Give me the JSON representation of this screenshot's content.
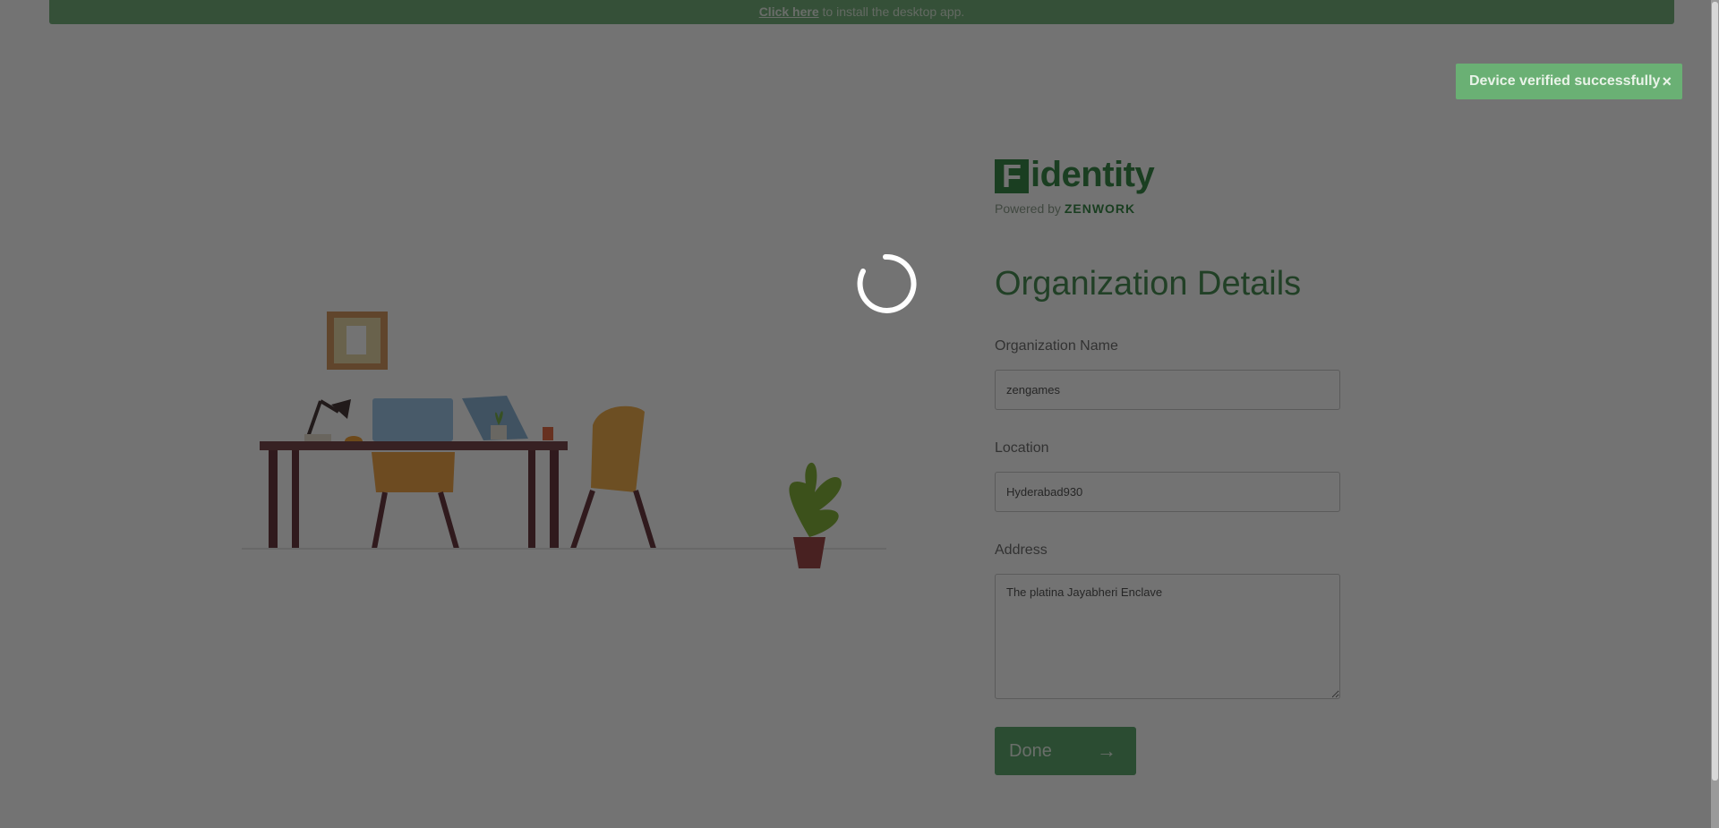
{
  "banner": {
    "link_text": "Click here",
    "rest_text": " to install the desktop app."
  },
  "toast": {
    "message": "Device verified successfully",
    "close_symbol": "×"
  },
  "brand": {
    "logo_letter": "F",
    "logo_word": "identity",
    "powered_by": "Powered by",
    "company": "ZENWORK"
  },
  "form": {
    "title": "Organization Details",
    "org_name_label": "Organization Name",
    "org_name_value": "zengames",
    "location_label": "Location",
    "location_value": "Hyderabad930",
    "address_label": "Address",
    "address_value": "The platina Jayabheri Enclave",
    "done_label": "Done",
    "done_icon": "arrow-right-icon"
  },
  "colors": {
    "brand_green": "#3b8b49",
    "banner_green": "#76b27c",
    "overlay": "rgba(0,0,0,0.55)"
  }
}
